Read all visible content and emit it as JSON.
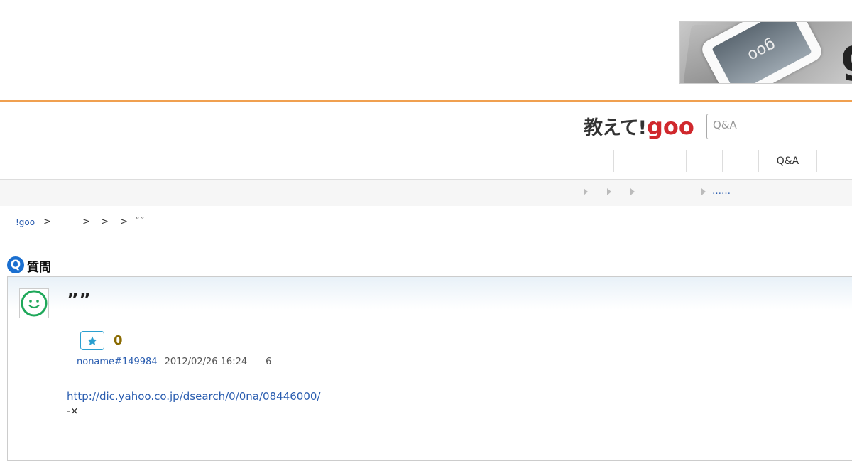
{
  "ad": {
    "screen_text": "goo",
    "brand_letter": "g"
  },
  "header": {
    "logo_text": "教えて!",
    "logo_goo": "goo",
    "search_placeholder": "Q&A",
    "nav_qa": "Q&A"
  },
  "subnav": {
    "more": "……"
  },
  "breadcrumb": {
    "home": "!goo",
    "sep": ">",
    "current": "“”"
  },
  "question": {
    "badge": "Q",
    "label": "質問",
    "title": "””",
    "like_count": "0",
    "username": "noname#149984",
    "date": "2012/02/26 16:24",
    "views": "6",
    "body_link": "http://dic.yahoo.co.jp/dsearch/0/0na/08446000/",
    "body_text": "-×"
  },
  "colors": {
    "accent_orange": "#f0a050",
    "link_blue": "#2a5db0",
    "brand_red": "#d0282d",
    "q_blue": "#1a6fd0",
    "avatar_green": "#1fa85a"
  }
}
